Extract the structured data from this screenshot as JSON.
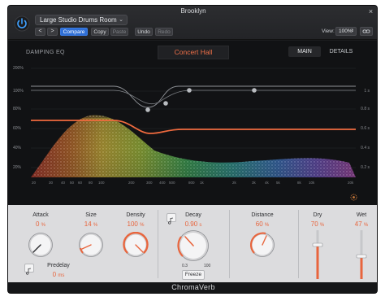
{
  "window": {
    "title": "Brooklyn"
  },
  "header": {
    "preset": "Large Studio Drums Room",
    "prev_label": "<",
    "next_label": ">",
    "compare_label": "Compare",
    "copy_label": "Copy",
    "paste_label": "Paste",
    "undo_label": "Undo",
    "redo_label": "Redo",
    "view_label": "View:",
    "view_zoom": "100%"
  },
  "display": {
    "damping_label": "DAMPING EQ",
    "mode": "Concert Hall",
    "tabs": [
      {
        "label": "MAIN",
        "active": true
      },
      {
        "label": "DETAILS",
        "active": false
      }
    ],
    "percent_labels": [
      "200%",
      "100%",
      "80%",
      "60%",
      "40%",
      "20%"
    ],
    "time_labels": [
      "1 s",
      "0.8 s",
      "0.6 s",
      "0.4 s",
      "0.2 s"
    ],
    "freq_labels": [
      "20",
      "30",
      "40",
      "50",
      "60",
      "80",
      "100",
      "200",
      "300",
      "400",
      "500",
      "800",
      "1k",
      "2k",
      "3k",
      "4k",
      "5k",
      "8k",
      "10k",
      "20k"
    ]
  },
  "controls": {
    "attack": {
      "label": "Attack",
      "value": "0",
      "unit": "%",
      "fraction": 0.0
    },
    "size": {
      "label": "Size",
      "value": "14",
      "unit": "%",
      "fraction": 0.14
    },
    "density": {
      "label": "Density",
      "value": "100",
      "unit": "%",
      "fraction": 1.0
    },
    "predelay": {
      "label": "Predelay",
      "value": "0",
      "unit": "ms"
    },
    "decay": {
      "label": "Decay",
      "value": "0.90",
      "unit": "s",
      "range_min": "0.3",
      "range_max": "100",
      "freeze_label": "Freeze"
    },
    "distance": {
      "label": "Distance",
      "value": "60",
      "unit": "%",
      "fraction": 0.6
    },
    "dry": {
      "label": "Dry",
      "value": "70",
      "unit": "%",
      "fraction": 0.7
    },
    "wet": {
      "label": "Wet",
      "value": "47",
      "unit": "%",
      "fraction": 0.47
    }
  },
  "footer": {
    "plugin_name": "ChromaVerb"
  },
  "colors": {
    "accent": "#e8653d",
    "compare_active": "#2f6fd6",
    "background": "#1c1d1f",
    "panel": "#dcdcde"
  },
  "icons": [
    "power-icon",
    "chevron-down-icon",
    "link-icon",
    "close-icon",
    "note-icon",
    "spectrum-icon"
  ]
}
